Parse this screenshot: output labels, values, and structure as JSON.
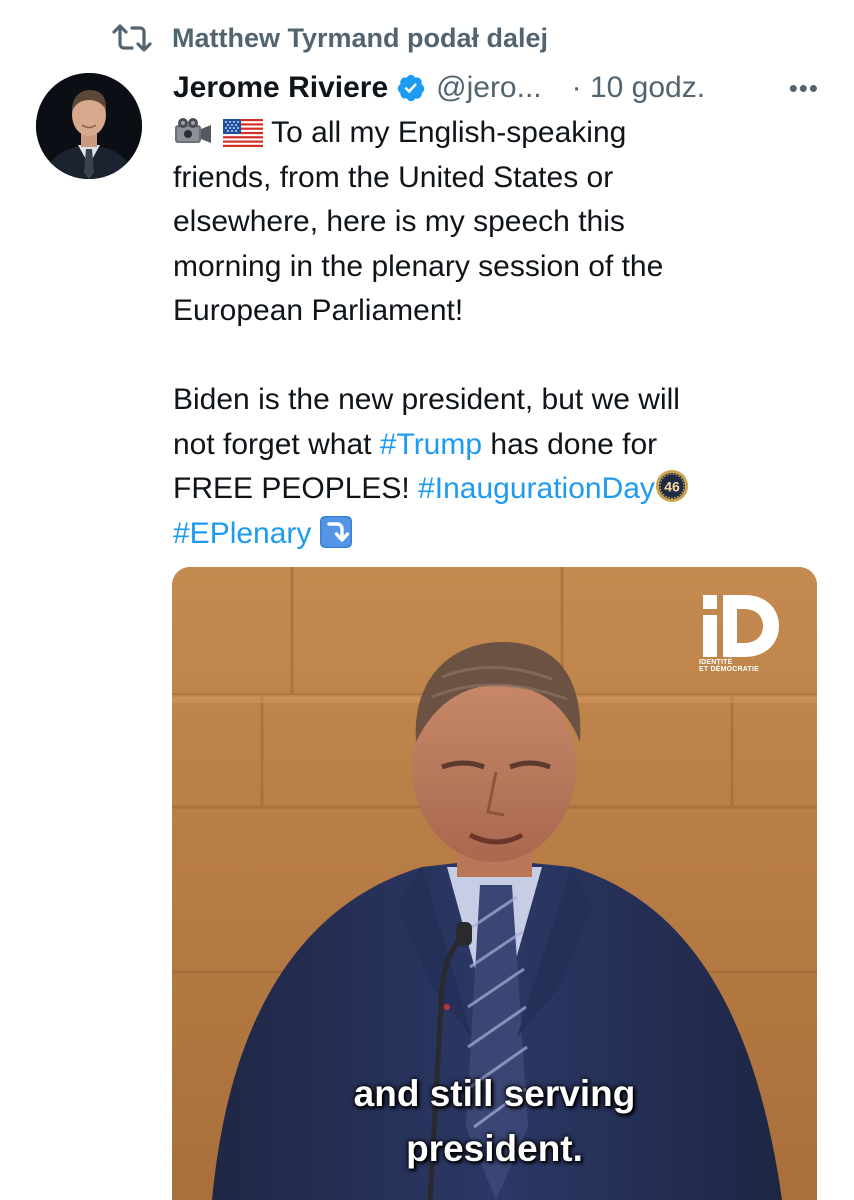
{
  "retweet": {
    "text": "Matthew Tyrmand podał dalej",
    "icon": "retweet-icon"
  },
  "author": {
    "name": "Jerome Riviere",
    "verified_icon": "verified-badge-icon",
    "handle": "@jero...",
    "time": "· 10 godz.",
    "more_icon": "more-options-icon",
    "more_text": "•••"
  },
  "tweet": {
    "lines": [
      "To all my English-speaking",
      "friends, from the United States or",
      "elsewhere, here is my speech this",
      "morning in the plenary session of the",
      "European Parliament!"
    ],
    "p2_line1": "Biden is the new president, but we will",
    "p2_line2_pre": "not forget what ",
    "p2_line2_tag": "#Trump",
    "p2_line2_post": " has done for",
    "p2_line3_pre": "FREE PEOPLES! ",
    "p2_line3_tag": "#InaugurationDay",
    "p2_line4_tag": "#EPlenary",
    "emoji_46": "46",
    "icons": [
      "video-camera-icon",
      "us-flag-icon",
      "badge-46-icon",
      "arrow-down-icon"
    ]
  },
  "media": {
    "logo_text": "ID",
    "logo_sub_1": "IDENTITÉ",
    "logo_sub_2": "ET DÉMOCRATIE",
    "caption_line1": "and still serving",
    "caption_line2": "president."
  },
  "colors": {
    "link": "#1d9bf0",
    "secondary": "#536471",
    "text": "#0f1419",
    "verified": "#1d9bf0"
  }
}
